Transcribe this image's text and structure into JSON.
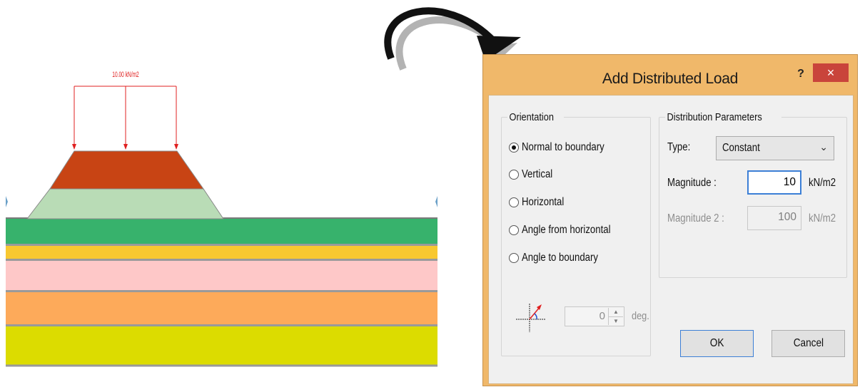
{
  "model": {
    "load_label": "10.00 kN/m2",
    "colors": {
      "load_line": "#e02020",
      "embankment_top": "#c84414",
      "embankment_bottom": "#b9dcb6",
      "layer1": "#37b26c",
      "layer2": "#f8c830",
      "layer3": "#fec8c8",
      "layer4": "#fdaa5a",
      "layer5": "#dcdc00",
      "boundary": "#9a9a9a"
    }
  },
  "arrow": {
    "icon": "curved-arrow-icon"
  },
  "dialog": {
    "title": "Add Distributed Load",
    "help_label": "?",
    "close_label": "×",
    "orientation": {
      "legend": "Orientation",
      "options": [
        {
          "label": "Normal to boundary",
          "checked": true
        },
        {
          "label": "Vertical",
          "checked": false
        },
        {
          "label": "Horizontal",
          "checked": false
        },
        {
          "label": "Angle from horizontal",
          "checked": false
        },
        {
          "label": "Angle to boundary",
          "checked": false
        }
      ],
      "angle_value": "0",
      "angle_unit": "deg."
    },
    "distribution": {
      "legend": "Distribution Parameters",
      "type_label": "Type:",
      "type_value": "Constant",
      "magnitude_label": "Magnitude :",
      "magnitude_value": "10",
      "magnitude_unit": "kN/m2",
      "magnitude2_label": "Magnitude 2 :",
      "magnitude2_value": "100",
      "magnitude2_unit": "kN/m2"
    },
    "ok_label": "OK",
    "cancel_label": "Cancel"
  }
}
